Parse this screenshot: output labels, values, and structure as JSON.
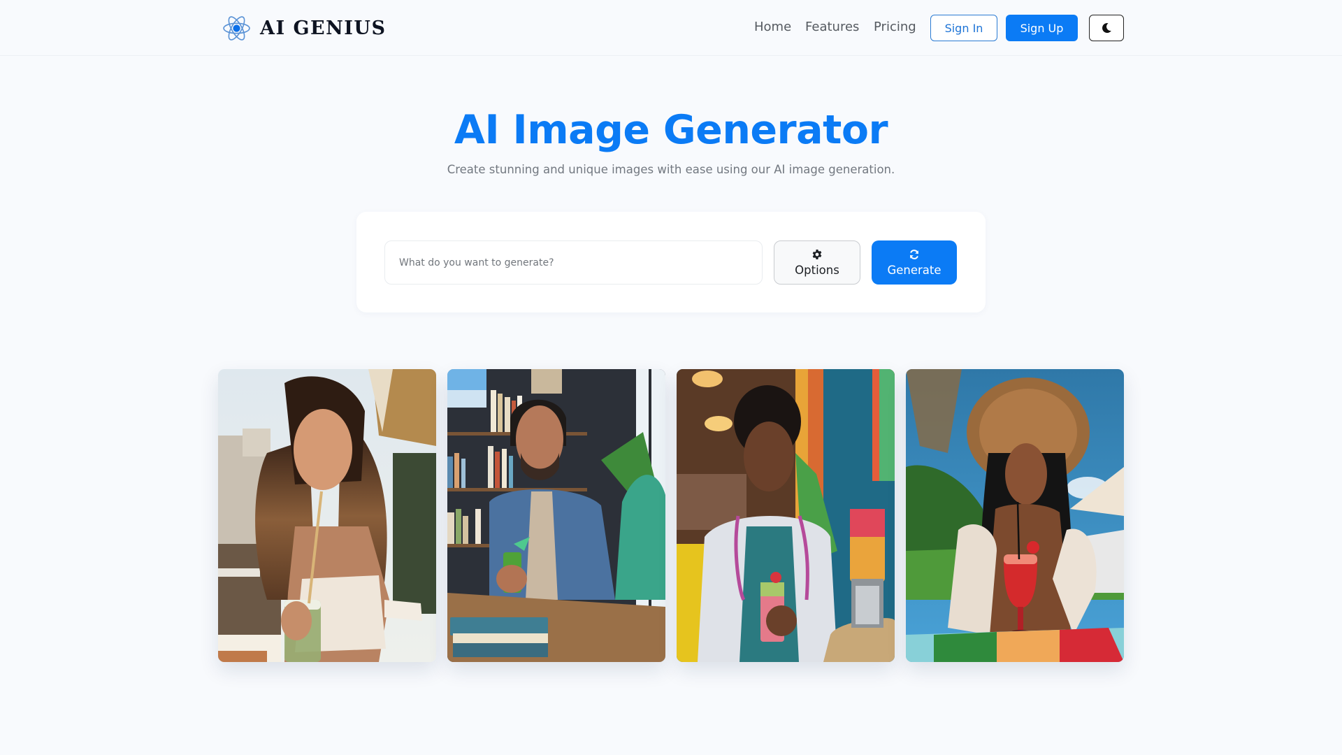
{
  "header": {
    "brand": {
      "name": "AI GENIUS",
      "icon": "atom-icon"
    },
    "nav": [
      {
        "label": "Home"
      },
      {
        "label": "Features"
      },
      {
        "label": "Pricing"
      }
    ],
    "sign_in_label": "Sign In",
    "sign_up_label": "Sign Up",
    "theme_toggle": {
      "icon": "moon-icon",
      "mode": "light"
    }
  },
  "hero": {
    "title": "AI Image Generator",
    "subtitle": "Create stunning and unique images with ease using our AI image generation."
  },
  "prompt": {
    "value": "",
    "placeholder": "What do you want to generate?",
    "options_label": "Options",
    "options_icon": "gear-icon",
    "generate_label": "Generate",
    "generate_icon": "refresh-icon"
  },
  "gallery": {
    "images": [
      {
        "alt": "Woman with long wavy hair sipping a green smoothie through a straw at an outdoor cafe"
      },
      {
        "alt": "Bearded man in a blue shirt holding a green drink with a cocktail umbrella in front of bookshelves"
      },
      {
        "alt": "Doctor in scrubs and white coat with stethoscope holding a pink smoothie beside a blender"
      },
      {
        "alt": "Woman in a straw hat sipping a red strawberry smoothie outdoors under blue sky"
      }
    ]
  },
  "colors": {
    "accent": "#0b7bf5",
    "background": "#f8fafd",
    "text_muted": "#727880"
  }
}
